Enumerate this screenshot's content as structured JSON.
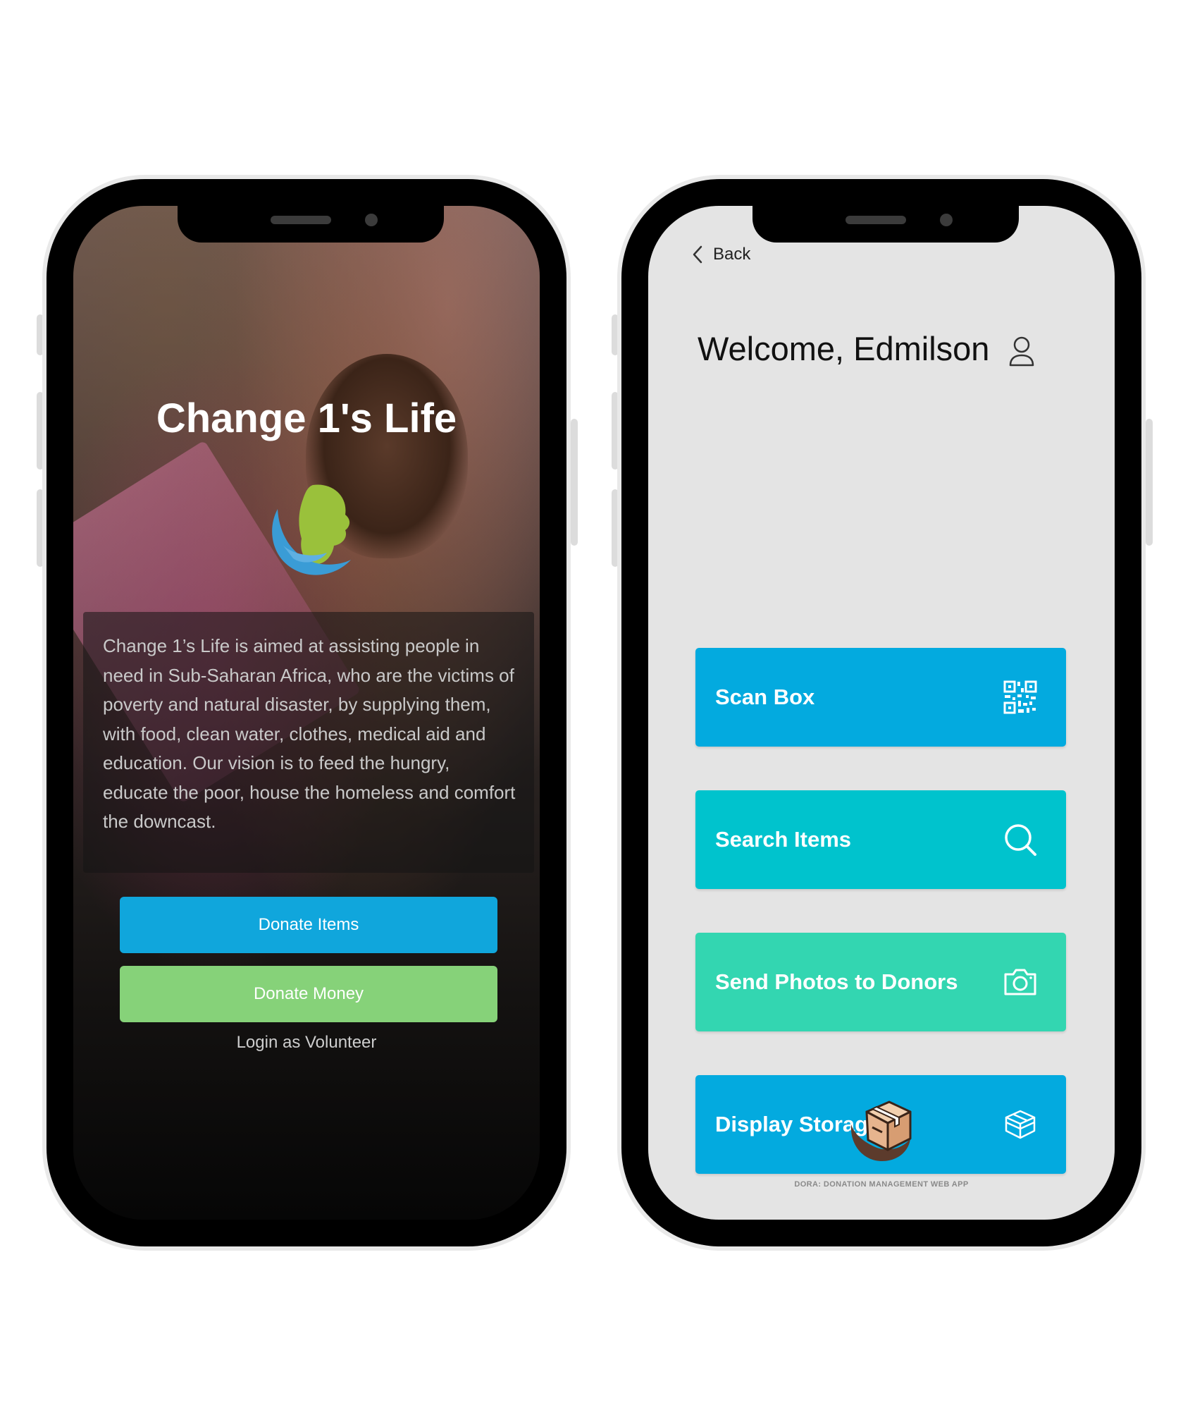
{
  "left_app": {
    "title": "Change 1's Life",
    "description": "Change 1’s Life is aimed at assisting people in need in Sub-Saharan Africa, who are the victims of poverty and natural disaster, by supplying them, with food, clean water, clothes, medical aid and education. Our vision is to feed the hungry, educate the poor, house the homeless and comfort the downcast.",
    "donate_items_label": "Donate Items",
    "donate_money_label": "Donate Money",
    "login_label": "Login as Volunteer",
    "colors": {
      "primary": "#10a6dc",
      "secondary": "#86d279"
    }
  },
  "right_app": {
    "back_label": "Back",
    "welcome_text": "Welcome, Edmilson",
    "actions": [
      {
        "label": "Scan Box",
        "icon": "qr-code-icon",
        "color": "#03aadf"
      },
      {
        "label": "Search Items",
        "icon": "search-icon",
        "color": "#00c3cd"
      },
      {
        "label": "Send Photos to Donors",
        "icon": "camera-icon",
        "color": "#33d6b1"
      },
      {
        "label": "Display Storage",
        "icon": "storage-box-icon",
        "color": "#03aadf"
      }
    ],
    "footer_text": "DORA: DONATION MANAGEMENT WEB APP",
    "background": "#e4e4e4"
  }
}
